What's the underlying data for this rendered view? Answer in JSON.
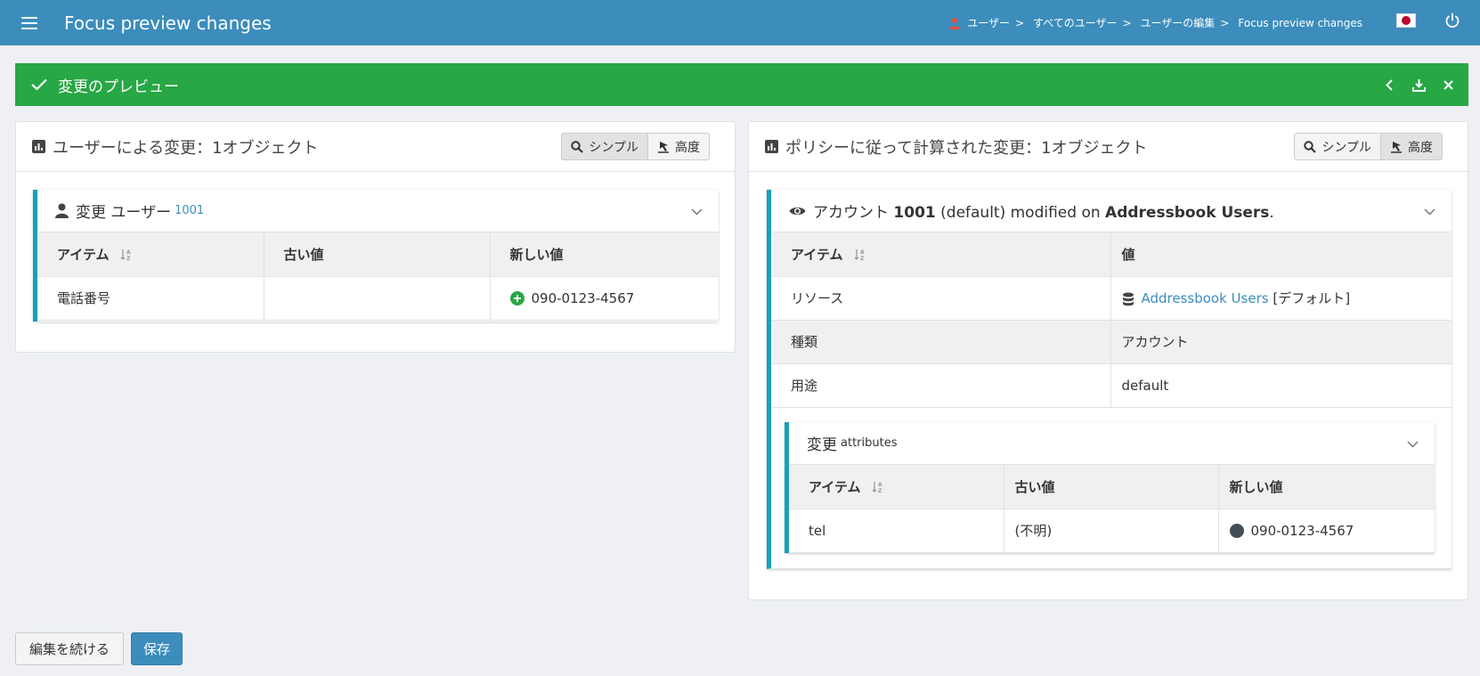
{
  "header": {
    "title": "Focus preview changes",
    "breadcrumbs": [
      "ユーザー",
      "すべてのユーザー",
      "ユーザーの編集",
      "Focus preview changes"
    ],
    "separator": ">"
  },
  "preview_bar": {
    "title": "変更のプレビュー"
  },
  "left_panel": {
    "title": "ユーザーによる変更：1オブジェクト",
    "simple_label": "シンプル",
    "advanced_label": "高度",
    "box": {
      "title": "変更 ユーザー",
      "subtitle": "1001",
      "columns": [
        "アイテム",
        "古い値",
        "新しい値"
      ],
      "rows": [
        {
          "item": "電話番号",
          "old": "",
          "new": "090-0123-4567"
        }
      ]
    }
  },
  "right_panel": {
    "title": "ポリシーに従って計算された変更：1オブジェクト",
    "simple_label": "シンプル",
    "advanced_label": "高度",
    "box": {
      "title_prefix": "アカウント",
      "account_id": "1001",
      "intent": "(default) modified on",
      "resource_name": "Addressbook Users",
      "title_suffix": ".",
      "columns": [
        "アイテム",
        "値"
      ],
      "rows": [
        {
          "item": "リソース",
          "value_link": "Addressbook Users",
          "value_extra": "[デフォルト]"
        },
        {
          "item": "種類",
          "value": "アカウント"
        },
        {
          "item": "用途",
          "value": "default"
        }
      ],
      "inner": {
        "title": "変更",
        "subtitle": "attributes",
        "columns": [
          "アイテム",
          "古い値",
          "新しい値"
        ],
        "rows": [
          {
            "item": "tel",
            "old": "(不明)",
            "new": "090-0123-4567"
          }
        ]
      }
    }
  },
  "footer": {
    "continue_label": "編集を続ける",
    "save_label": "保存"
  },
  "colors": {
    "header": "#3c8dbc",
    "success": "#28a745",
    "accent": "#17a2b8",
    "flag_red": "#bc002d"
  }
}
